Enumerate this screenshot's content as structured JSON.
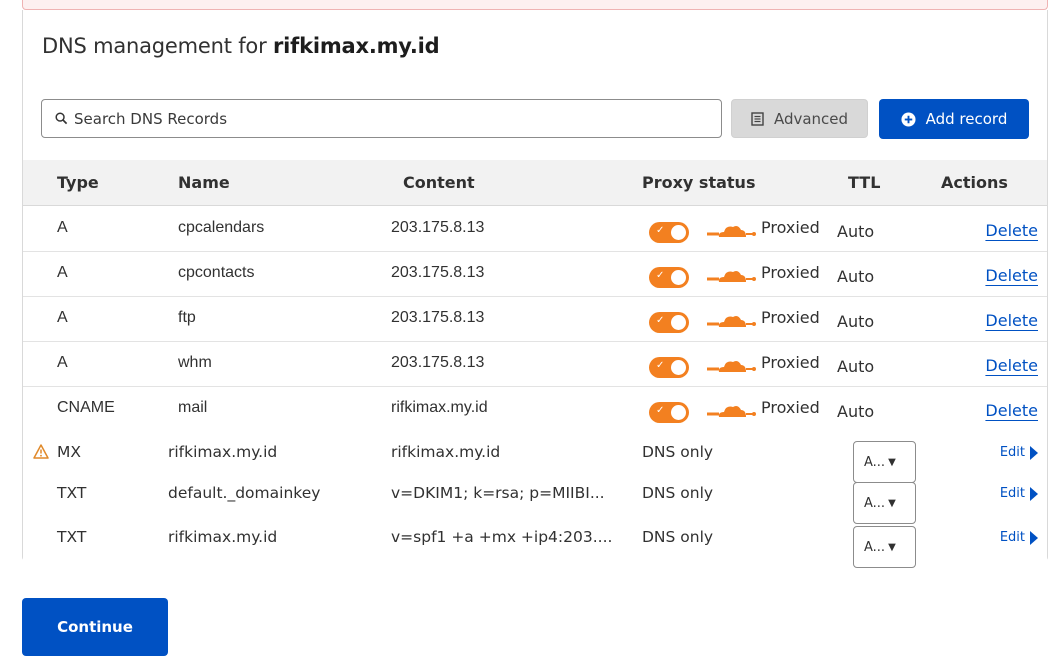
{
  "page": {
    "title_prefix": "DNS management for ",
    "domain": "rifkimax.my.id"
  },
  "toolbar": {
    "search_placeholder": "Search DNS Records",
    "advanced_label": "Advanced",
    "add_record_label": "Add record"
  },
  "table": {
    "headers": [
      "Type",
      "Name",
      "Content",
      "Proxy status",
      "TTL",
      "Actions"
    ],
    "rows": [
      {
        "type": "A",
        "name": "cpcalendars",
        "content": "203.175.8.13",
        "proxy": "Proxied",
        "ttl": "Auto",
        "action": "Delete"
      },
      {
        "type": "A",
        "name": "cpcontacts",
        "content": "203.175.8.13",
        "proxy": "Proxied",
        "ttl": "Auto",
        "action": "Delete"
      },
      {
        "type": "A",
        "name": "ftp",
        "content": "203.175.8.13",
        "proxy": "Proxied",
        "ttl": "Auto",
        "action": "Delete"
      },
      {
        "type": "A",
        "name": "whm",
        "content": "203.175.8.13",
        "proxy": "Proxied",
        "ttl": "Auto",
        "action": "Delete"
      },
      {
        "type": "CNAME",
        "name": "mail",
        "content": "rifkimax.my.id",
        "proxy": "Proxied",
        "ttl": "Auto",
        "action": "Delete"
      },
      {
        "type": "MX",
        "name": "rifkimax.my.id",
        "content": "rifkimax.my.id",
        "proxy": "DNS only",
        "ttl": "A...",
        "action": "Edit",
        "warning": true
      },
      {
        "type": "TXT",
        "name": "default._domainkey",
        "content": "v=DKIM1; k=rsa; p=MIIBI...",
        "proxy": "DNS only",
        "ttl": "A...",
        "action": "Edit"
      },
      {
        "type": "TXT",
        "name": "rifkimax.my.id",
        "content": "v=spf1 +a +mx +ip4:203....",
        "proxy": "DNS only",
        "ttl": "A...",
        "action": "Edit"
      }
    ]
  },
  "footer": {
    "continue_label": "Continue"
  },
  "colors": {
    "accent": "#0051c3",
    "proxy_orange": "#f38020"
  }
}
